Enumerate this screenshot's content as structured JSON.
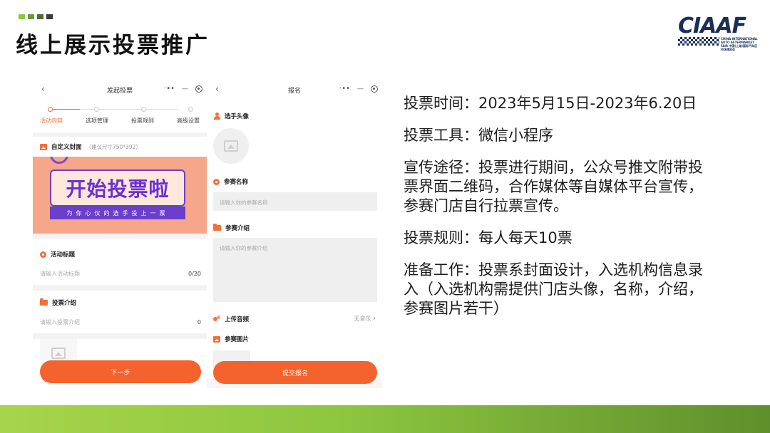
{
  "slide": {
    "title": "线上展示投票推广",
    "deco_colors": [
      "#8cc63f",
      "#6a9a37",
      "#4e6b2e",
      "#3a3a3a"
    ]
  },
  "logo": {
    "mark": "CIAAF",
    "subtitle": "CHINA INTERNATIONAL AUTO AFTERMARKET FAIR 中国(上海)国际汽车后市场博览会"
  },
  "phone1": {
    "nav_title": "发起投票",
    "steps": [
      "活动内容",
      "选项管理",
      "投票规则",
      "高级设置"
    ],
    "active_step": 0,
    "cover": {
      "label": "自定义封面",
      "hint": "（建议尺寸750*392）",
      "banner_title": "开始投票啦",
      "banner_subtitle": "为你心仪的选手投上一票"
    },
    "activity_title": {
      "label": "活动标题",
      "placeholder": "请输入活动标题",
      "count": "0/20"
    },
    "vote_intro": {
      "label": "投票介绍",
      "placeholder": "请输入投票介绍",
      "count": "0"
    },
    "next_button": "下一步"
  },
  "phone2": {
    "nav_title": "报名",
    "avatar_label": "选手头像",
    "name_label": "参赛名称",
    "name_placeholder": "请输入你的参赛名称",
    "intro_label": "参赛介绍",
    "intro_placeholder": "请输入你的参赛介绍",
    "audio_label": "上传音频",
    "audio_value": "无音乐",
    "images_label": "参赛图片",
    "submit_button": "提交报名"
  },
  "info": {
    "time": "投票时间：2023年5月15日-2023年6.20日",
    "tool": "投票工具：微信小程序",
    "channels": "宣传途径：投票进行期间，公众号推文附带投票界面二维码，合作媒体等自媒体平台宣传，参赛门店自行拉票宣传。",
    "rules": "投票规则：每人每天10票",
    "preparation": "准备工作：投票系封面设计，入选机构信息录入（入选机构需提供门店头像，名称，介绍，参赛图片若干）"
  },
  "colors": {
    "accent": "#f4622d",
    "brand": "#1b2e5a",
    "green": "#8cc63f"
  }
}
